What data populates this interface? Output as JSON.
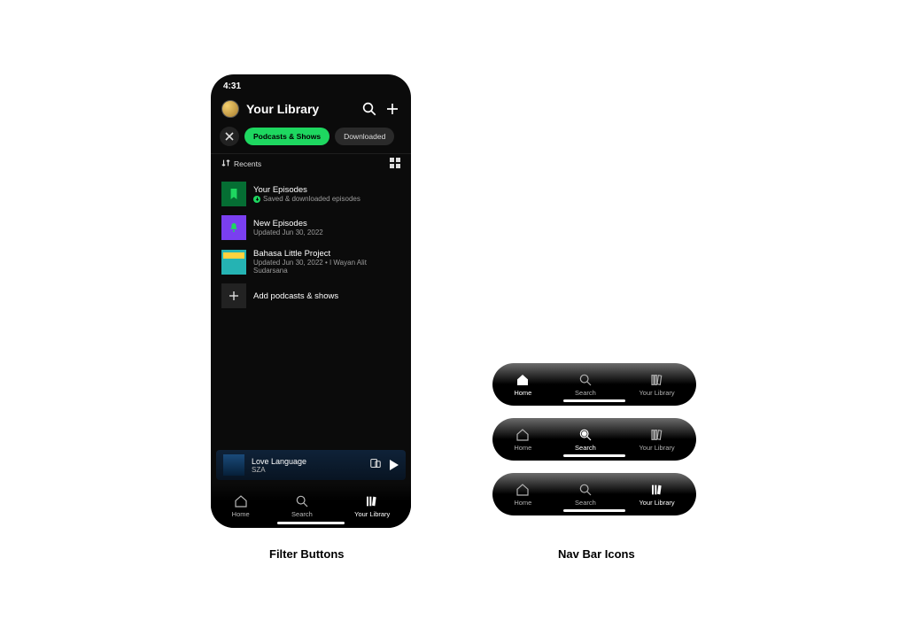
{
  "captions": {
    "left": "Filter Buttons",
    "right": "Nav Bar Icons"
  },
  "status": {
    "time": "4:31"
  },
  "header": {
    "title": "Your Library"
  },
  "chips": {
    "active": "Podcasts & Shows",
    "second": "Downloaded"
  },
  "sort": {
    "label": "Recents"
  },
  "items": [
    {
      "title": "Your Episodes",
      "sub": "Saved & downloaded episodes",
      "saved": true
    },
    {
      "title": "New Episodes",
      "sub": "Updated Jun 30, 2022"
    },
    {
      "title": "Bahasa Little Project",
      "sub": "Updated Jun 30, 2022 • I Wayan Alit Sudarsana"
    }
  ],
  "add": {
    "label": "Add podcasts & shows"
  },
  "nowplaying": {
    "title": "Love Language",
    "artist": "SZA"
  },
  "tabs": {
    "home": "Home",
    "search": "Search",
    "library": "Your Library"
  }
}
